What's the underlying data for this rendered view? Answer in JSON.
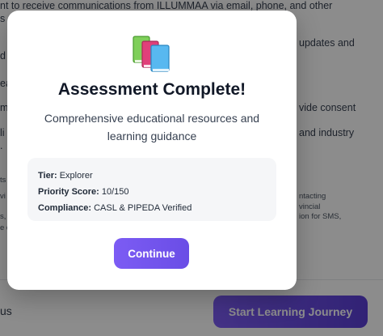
{
  "background": {
    "lines": [
      "nt to receive communications from ILLUMMAA via email, phone, and other",
      "s",
      "updates and",
      "d",
      "ea",
      "m",
      "vide consent",
      "li",
      "and industry",
      "."
    ],
    "small_lines": [
      "ts",
      "vi",
      "s,",
      "e d",
      "ntacting",
      "vincial",
      "ion for SMS,"
    ],
    "footer_text": "us",
    "cta_label": "Start Learning Journey"
  },
  "modal": {
    "icon": "books-icon",
    "title": "Assessment Complete!",
    "subtitle": "Comprehensive educational resources and learning guidance",
    "details": [
      {
        "key": "Tier:",
        "value": "Explorer"
      },
      {
        "key": "Priority Score:",
        "value": "10/150"
      },
      {
        "key": "Compliance:",
        "value": "CASL & PIPEDA Verified"
      }
    ],
    "continue_label": "Continue"
  },
  "colors": {
    "accent": "#7c5cf4",
    "overlay": "rgba(0,0,0,0.45)"
  }
}
